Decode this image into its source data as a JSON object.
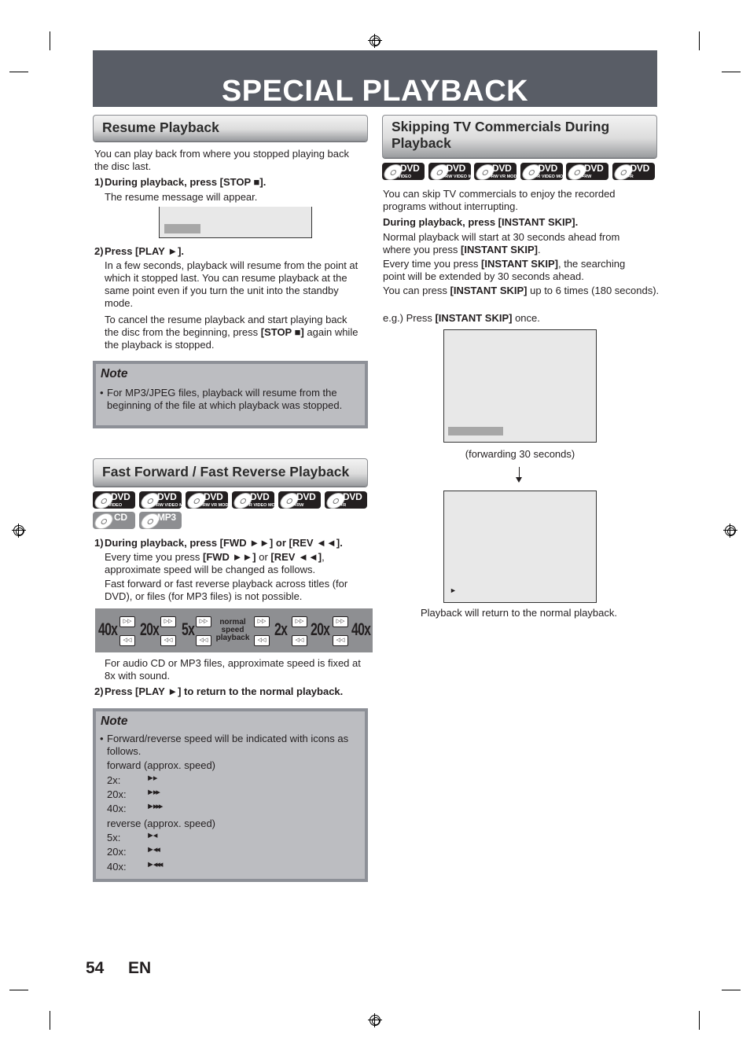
{
  "page": {
    "title": "SPECIAL PLAYBACK",
    "page_number": "54",
    "language": "EN"
  },
  "resume": {
    "heading": "Resume Playback",
    "intro": "You can play back from where you stopped playing back the disc last.",
    "step1_num": "1)",
    "step1_label": "During playback, press [STOP ■].",
    "step1_desc": "The resume message will appear.",
    "step2_num": "2)",
    "step2_label": "Press [PLAY ►].",
    "step2_desc_1": "In a few seconds, playback will resume from the point at which it stopped last. You can resume playback at the same point even if you turn the unit into the standby mode.",
    "step2_desc_2_pre": "To cancel the resume playback and start playing back the disc from the beginning, press ",
    "step2_desc_2_key": "[STOP ■]",
    "step2_desc_2_post": " again while the playback is stopped.",
    "note_title": "Note",
    "note_text": "For MP3/JPEG files, playback will resume from the beginning of the file at which playback was stopped."
  },
  "fast": {
    "heading": "Fast Forward / Fast Reverse Playback",
    "discs": [
      {
        "label": "DVD",
        "sub": "VIDEO"
      },
      {
        "label": "DVD",
        "sub": "-RW VIDEO MODE"
      },
      {
        "label": "DVD",
        "sub": "-RW VR MODE"
      },
      {
        "label": "DVD",
        "sub": "-R VIDEO MODE"
      },
      {
        "label": "DVD",
        "sub": "+RW"
      },
      {
        "label": "DVD",
        "sub": "+R"
      },
      {
        "label": "CD",
        "sub": ""
      },
      {
        "label": "MP3",
        "sub": ""
      }
    ],
    "step1_num": "1)",
    "step1_label": "During playback, press [FWD ►►] or [REV ◄◄].",
    "step1_desc_pre": "Every time you press ",
    "step1_desc_key1": "[FWD ►►]",
    "step1_desc_mid": " or ",
    "step1_desc_key2": "[REV ◄◄]",
    "step1_desc_post": ", approximate speed will be changed as follows.",
    "step1_desc_2": "Fast forward or fast reverse playback across titles (for DVD), or files (for MP3 files) is not possible.",
    "speeds": [
      "40x",
      "20x",
      "5x",
      "2x",
      "20x",
      "40x"
    ],
    "normal_speed": [
      "normal",
      "speed",
      "playback"
    ],
    "audio_note": "For audio CD or MP3 files, approximate speed is fixed at 8x with sound.",
    "step2_num": "2)",
    "step2_label": "Press [PLAY ►] to return to the normal playback.",
    "note_title": "Note",
    "note_text": "Forward/reverse speed will be indicated with icons as follows.",
    "forward_label": "forward (approx. speed)",
    "forward": [
      {
        "speed": "2x:",
        "icon": "►▸"
      },
      {
        "speed": "20x:",
        "icon": "►▸▸"
      },
      {
        "speed": "40x:",
        "icon": "►▸▸▸"
      }
    ],
    "reverse_label": "reverse (approx. speed)",
    "reverse": [
      {
        "speed": "5x:",
        "icon": "►◂"
      },
      {
        "speed": "20x:",
        "icon": "►◂◂"
      },
      {
        "speed": "40x:",
        "icon": "►◂◂◂"
      }
    ]
  },
  "skip": {
    "heading_line1": "Skipping TV Commercials During",
    "heading_line2": "Playback",
    "discs": [
      {
        "label": "DVD",
        "sub": "VIDEO"
      },
      {
        "label": "DVD",
        "sub": "-RW VIDEO MODE"
      },
      {
        "label": "DVD",
        "sub": "-RW VR MODE"
      },
      {
        "label": "DVD",
        "sub": "-R VIDEO MODE"
      },
      {
        "label": "DVD",
        "sub": "+RW"
      },
      {
        "label": "DVD",
        "sub": "+R"
      }
    ],
    "intro": "You can skip TV commercials to enjoy the recorded programs without interrupting.",
    "instruction": "During playback, press [INSTANT SKIP].",
    "p1_pre": "Normal playback will start at 30 seconds ahead from where you press ",
    "p1_key": "[INSTANT SKIP]",
    "p1_post": ".",
    "p2_pre": "Every time you press ",
    "p2_key": "[INSTANT SKIP]",
    "p2_post": ", the searching point will be extended by 30 seconds ahead.",
    "p3_pre": "You can press ",
    "p3_key": "[INSTANT SKIP]",
    "p3_post": " up to 6 times (180 seconds).",
    "eg_pre": "e.g.) Press ",
    "eg_key": "[INSTANT SKIP]",
    "eg_post": " once.",
    "caption1": "(forwarding 30 seconds)",
    "caption2": "Playback will return to the normal playback.",
    "play_icon": "►"
  }
}
